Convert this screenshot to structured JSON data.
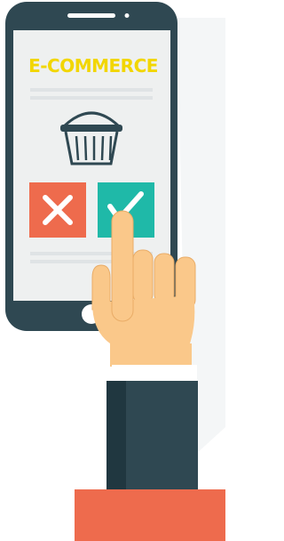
{
  "brand": {
    "title": "E-COMMERCE"
  },
  "icons": {
    "basket": "shopping-basket-icon",
    "reject": "close-icon",
    "accept": "check-icon"
  },
  "colors": {
    "phone_body": "#2f4852",
    "screen": "#eef0f0",
    "brand_text": "#f2d600",
    "reject_button": "#ee6b4d",
    "accept_button": "#1fb9a8",
    "skin": "#fac88a",
    "sleeve": "#2f4852",
    "cuff": "#ee6b4d"
  }
}
